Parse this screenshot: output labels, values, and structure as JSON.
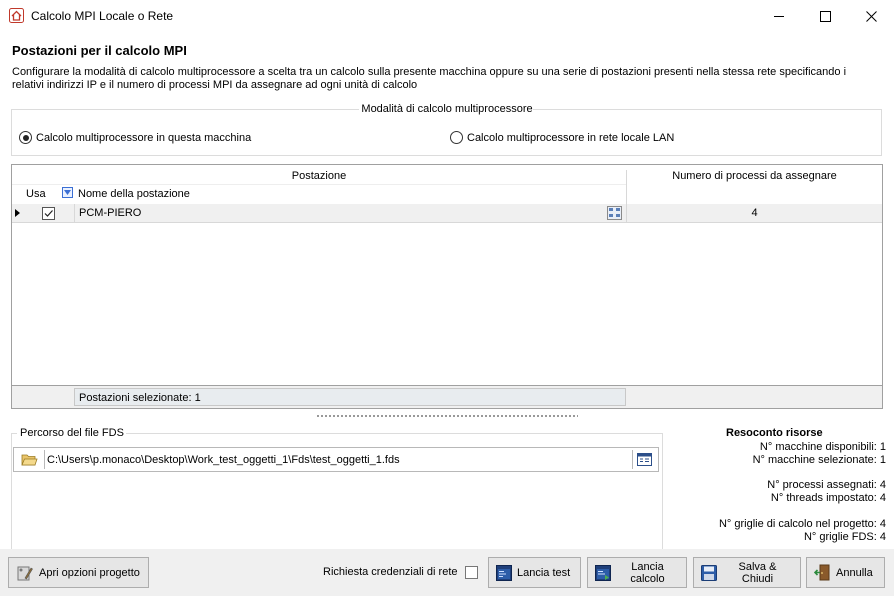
{
  "window": {
    "title": "Calcolo MPI Locale o Rete"
  },
  "header": {
    "title": "Postazioni per il calcolo MPI",
    "description": "Configurare la modalità di calcolo multiprocessore a scelta tra un calcolo sulla presente macchina oppure su una serie di postazioni presenti nella stessa rete specificando i relativi indirizzi IP e il numero di processi MPI da assegnare ad ogni unità di calcolo"
  },
  "mode": {
    "group_title": "Modalità di calcolo multiprocessore",
    "options": [
      {
        "label": "Calcolo multiprocessore in questa macchina",
        "selected": true
      },
      {
        "label": "Calcolo multiprocessore in rete locale LAN",
        "selected": false
      }
    ]
  },
  "grid": {
    "header_postazione": "Postazione",
    "header_numero": "Numero di processi da assegnare",
    "col_usa": "Usa",
    "col_nome": "Nome della postazione",
    "rows": [
      {
        "usa": true,
        "nome": "PCM-PIERO",
        "processi": "4"
      }
    ],
    "footer": "Postazioni selezionate: 1"
  },
  "fds": {
    "group_title": "Percorso del file FDS",
    "path": "C:\\Users\\p.monaco\\Desktop\\Work_test_oggetti_1\\Fds\\test_oggetti_1.fds"
  },
  "resources": {
    "title": "Resoconto risorse",
    "lines": [
      "N° macchine disponibili: 1",
      "N° macchine selezionate: 1",
      "N° processi assegnati: 4",
      "N° threads impostato: 4",
      "N° griglie di calcolo nel progetto: 4",
      "N° griglie FDS: 4"
    ]
  },
  "bottom": {
    "apri_opzioni": "Apri opzioni progetto",
    "credenziali_label": "Richiesta credenziali di rete",
    "credenziali_checked": false,
    "lancia_test": "Lancia test",
    "lancia_calcolo": "Lancia calcolo",
    "salva_chiudi": "Salva & Chiudi",
    "annulla": "Annulla"
  }
}
